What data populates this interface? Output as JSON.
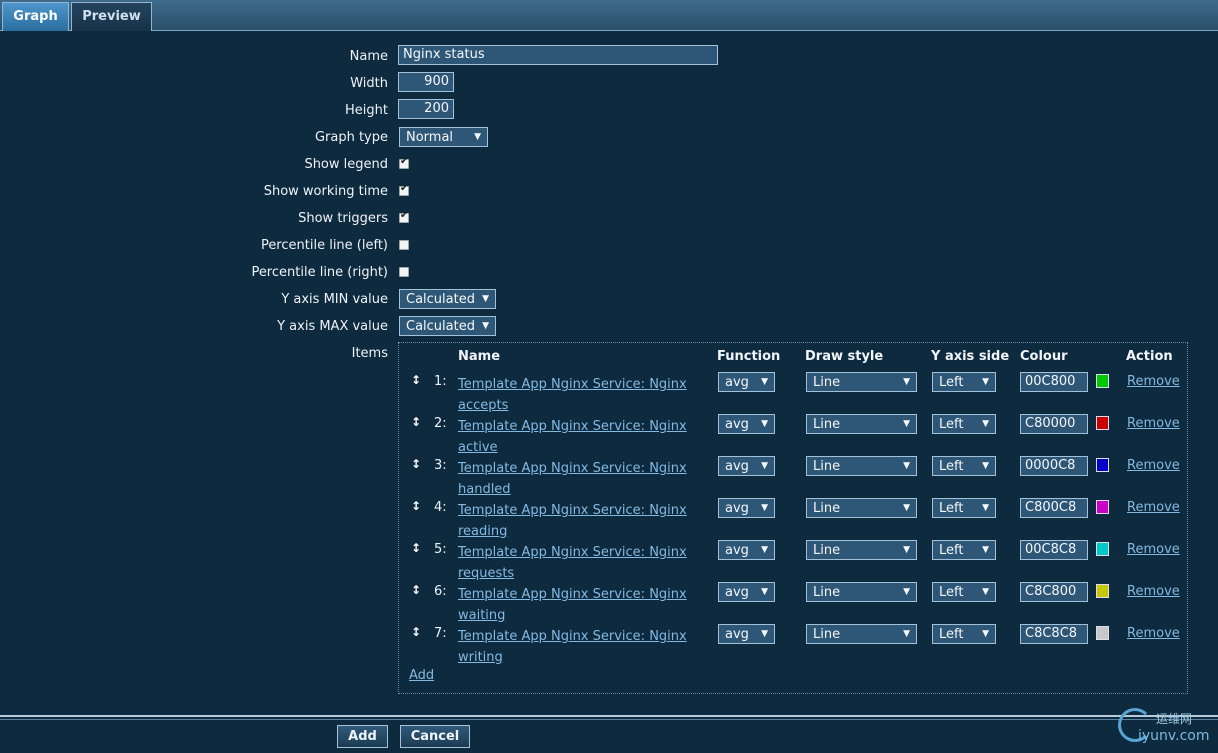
{
  "tabs": [
    {
      "label": "Graph",
      "active": true
    },
    {
      "label": "Preview",
      "active": false
    }
  ],
  "form": {
    "name_label": "Name",
    "name_value": "Nginx status",
    "width_label": "Width",
    "width_value": "900",
    "height_label": "Height",
    "height_value": "200",
    "graph_type_label": "Graph type",
    "graph_type_value": "Normal",
    "show_legend_label": "Show legend",
    "show_legend": true,
    "show_working_time_label": "Show working time",
    "show_working_time": true,
    "show_triggers_label": "Show triggers",
    "show_triggers": true,
    "percentile_left_label": "Percentile line (left)",
    "percentile_left": false,
    "percentile_right_label": "Percentile line (right)",
    "percentile_right": false,
    "ymin_label": "Y axis MIN value",
    "ymin_value": "Calculated",
    "ymax_label": "Y axis MAX value",
    "ymax_value": "Calculated",
    "items_label": "Items"
  },
  "items_table": {
    "headers": {
      "name": "Name",
      "function": "Function",
      "draw_style": "Draw style",
      "y_axis_side": "Y axis side",
      "colour": "Colour",
      "action": "Action"
    },
    "rows": [
      {
        "index": "1:",
        "name": "Template App Nginx Service: Nginx accepts",
        "function": "avg",
        "draw_style": "Line",
        "y_axis_side": "Left",
        "colour": "00C800",
        "swatch": "#00C800",
        "action": "Remove"
      },
      {
        "index": "2:",
        "name": "Template App Nginx Service: Nginx active",
        "function": "avg",
        "draw_style": "Line",
        "y_axis_side": "Left",
        "colour": "C80000",
        "swatch": "#C80000",
        "action": "Remove"
      },
      {
        "index": "3:",
        "name": "Template App Nginx Service: Nginx handled",
        "function": "avg",
        "draw_style": "Line",
        "y_axis_side": "Left",
        "colour": "0000C8",
        "swatch": "#0000C8",
        "action": "Remove"
      },
      {
        "index": "4:",
        "name": "Template App Nginx Service: Nginx reading",
        "function": "avg",
        "draw_style": "Line",
        "y_axis_side": "Left",
        "colour": "C800C8",
        "swatch": "#C800C8",
        "action": "Remove"
      },
      {
        "index": "5:",
        "name": "Template App Nginx Service: Nginx requests",
        "function": "avg",
        "draw_style": "Line",
        "y_axis_side": "Left",
        "colour": "00C8C8",
        "swatch": "#00C8C8",
        "action": "Remove"
      },
      {
        "index": "6:",
        "name": "Template App Nginx Service: Nginx waiting",
        "function": "avg",
        "draw_style": "Line",
        "y_axis_side": "Left",
        "colour": "C8C800",
        "swatch": "#C8C800",
        "action": "Remove"
      },
      {
        "index": "7:",
        "name": "Template App Nginx Service: Nginx writing",
        "function": "avg",
        "draw_style": "Line",
        "y_axis_side": "Left",
        "colour": "C8C8C8",
        "swatch": "#C8C8C8",
        "action": "Remove"
      }
    ],
    "add_link": "Add"
  },
  "buttons": {
    "add": "Add",
    "cancel": "Cancel"
  },
  "watermark": {
    "line1": "运维网",
    "line2": "iyunv.com"
  }
}
